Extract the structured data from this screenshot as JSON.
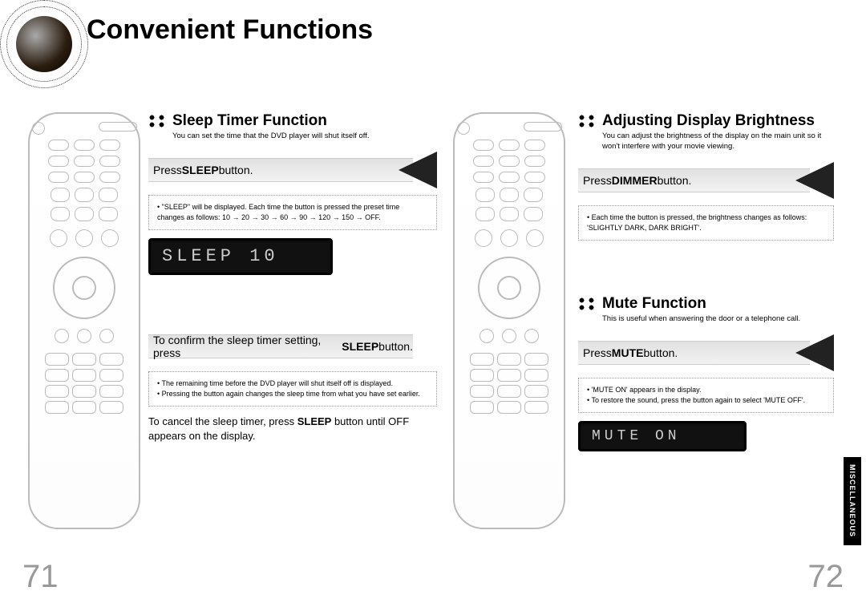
{
  "page_title": "Convenient Functions",
  "side_tab": "MISCELLANEOUS",
  "page_left_num": "71",
  "page_right_num": "72",
  "left": {
    "section_title": "Sleep Timer Function",
    "intro": "You can set the time that the DVD player will shut itself off.",
    "banner1_prefix": "Press ",
    "banner1_bold": "SLEEP",
    "banner1_suffix": " button.",
    "note1_line1": "\"SLEEP\" will be displayed. Each time the button is pressed the preset time changes as follows: 10 → 20 → 30 → 60 → 90 → 120 → 150 → OFF.",
    "lcd1": "SLEEP  10",
    "instruction2_prefix": "To confirm the sleep timer setting, press ",
    "instruction2_bold": "SLEEP",
    "instruction2_suffix": " button.",
    "note2_line1": "The remaining time before the DVD player will shut itself off is displayed.",
    "note2_line2": "Pressing the button again changes the sleep time from what you have set earlier.",
    "instruction3_prefix": "To cancel the sleep timer, press ",
    "instruction3_bold": "SLEEP",
    "instruction3_suffix": " button until OFF appears on the display."
  },
  "right": {
    "section1_title": "Adjusting Display Brightness",
    "intro1": "You can adjust the brightness of the display on the main unit so it won't interfere with your movie viewing.",
    "banner1_prefix": "Press ",
    "banner1_bold": "DIMMER",
    "banner1_suffix": " button.",
    "note1_line1": "Each time the button is pressed, the brightness changes as follows: 'SLIGHTLY DARK, DARK  BRIGHT'.",
    "section2_title": "Mute Function",
    "intro2": "This is useful when answering the door or a telephone call.",
    "banner2_prefix": "Press ",
    "banner2_bold": "MUTE",
    "banner2_suffix": " button.",
    "note2_line1": "'MUTE ON' appears in the display.",
    "note2_line2": "To restore the sound, press the button again to select 'MUTE OFF'.",
    "lcd2": "MUTE ON"
  }
}
